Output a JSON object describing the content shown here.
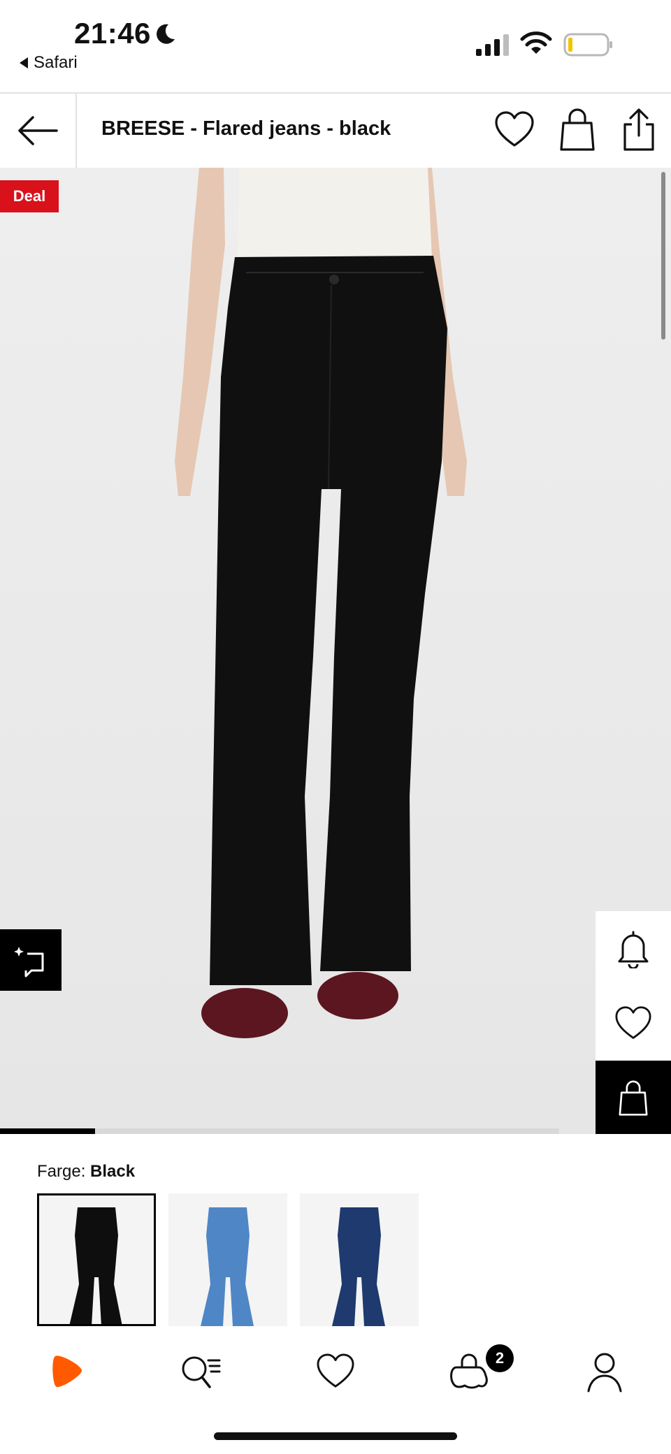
{
  "status_bar": {
    "time": "21:46",
    "back_app": "Safari",
    "icons": [
      "moon-icon",
      "signal-icon",
      "wifi-icon",
      "battery-icon"
    ]
  },
  "header": {
    "title": "BREESE - Flared jeans - black",
    "icons": [
      "arrow-left-icon",
      "heart-icon",
      "bag-icon",
      "share-icon"
    ]
  },
  "gallery": {
    "deal_badge": "Deal",
    "image_progress": 0.17,
    "side_actions": [
      "bell-icon",
      "heart-icon",
      "bag-icon"
    ]
  },
  "color": {
    "label": "Farge:",
    "selected": "Black",
    "swatches": [
      {
        "name": "black",
        "selected": true
      },
      {
        "name": "light-blue",
        "selected": false
      },
      {
        "name": "dark-blue",
        "selected": false
      }
    ]
  },
  "tab_bar": {
    "items": [
      "home-logo-icon",
      "search-icon",
      "wishlist-icon",
      "cart-icon",
      "profile-icon"
    ],
    "cart_count": "2"
  },
  "colors": {
    "accent": "#d8111b",
    "brand_orange": "#ff5a00",
    "background": "#ffffff",
    "gallery_background": "#ececec"
  }
}
